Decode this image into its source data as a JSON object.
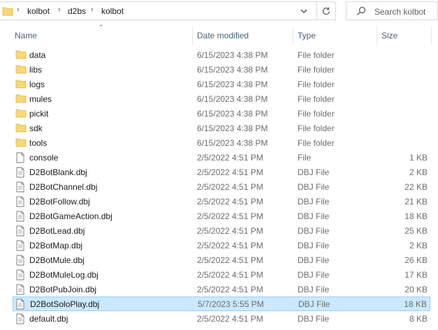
{
  "address_bar": {
    "crumbs": [
      "kolbot",
      "d2bs",
      "kolbot"
    ]
  },
  "search": {
    "placeholder": "Search kolbot"
  },
  "columns": {
    "name": "Name",
    "date": "Date modified",
    "type": "Type",
    "size": "Size"
  },
  "files": [
    {
      "name": "data",
      "date": "6/15/2023 4:38 PM",
      "type": "File folder",
      "size": "",
      "kind": "folder"
    },
    {
      "name": "libs",
      "date": "6/15/2023 4:38 PM",
      "type": "File folder",
      "size": "",
      "kind": "folder"
    },
    {
      "name": "logs",
      "date": "6/15/2023 4:38 PM",
      "type": "File folder",
      "size": "",
      "kind": "folder"
    },
    {
      "name": "mules",
      "date": "6/15/2023 4:38 PM",
      "type": "File folder",
      "size": "",
      "kind": "folder"
    },
    {
      "name": "pickit",
      "date": "6/15/2023 4:38 PM",
      "type": "File folder",
      "size": "",
      "kind": "folder"
    },
    {
      "name": "sdk",
      "date": "6/15/2023 4:38 PM",
      "type": "File folder",
      "size": "",
      "kind": "folder"
    },
    {
      "name": "tools",
      "date": "6/15/2023 4:38 PM",
      "type": "File folder",
      "size": "",
      "kind": "folder"
    },
    {
      "name": "console",
      "date": "2/5/2022 4:51 PM",
      "type": "File",
      "size": "1 KB",
      "kind": "blank"
    },
    {
      "name": "D2BotBlank.dbj",
      "date": "2/5/2022 4:51 PM",
      "type": "DBJ File",
      "size": "2 KB",
      "kind": "doc"
    },
    {
      "name": "D2BotChannel.dbj",
      "date": "2/5/2022 4:51 PM",
      "type": "DBJ File",
      "size": "22 KB",
      "kind": "doc"
    },
    {
      "name": "D2BotFollow.dbj",
      "date": "2/5/2022 4:51 PM",
      "type": "DBJ File",
      "size": "21 KB",
      "kind": "doc"
    },
    {
      "name": "D2BotGameAction.dbj",
      "date": "2/5/2022 4:51 PM",
      "type": "DBJ File",
      "size": "18 KB",
      "kind": "doc"
    },
    {
      "name": "D2BotLead.dbj",
      "date": "2/5/2022 4:51 PM",
      "type": "DBJ File",
      "size": "25 KB",
      "kind": "doc"
    },
    {
      "name": "D2BotMap.dbj",
      "date": "2/5/2022 4:51 PM",
      "type": "DBJ File",
      "size": "2 KB",
      "kind": "doc"
    },
    {
      "name": "D2BotMule.dbj",
      "date": "2/5/2022 4:51 PM",
      "type": "DBJ File",
      "size": "26 KB",
      "kind": "doc"
    },
    {
      "name": "D2BotMuleLog.dbj",
      "date": "2/5/2022 4:51 PM",
      "type": "DBJ File",
      "size": "17 KB",
      "kind": "doc"
    },
    {
      "name": "D2BotPubJoin.dbj",
      "date": "2/5/2022 4:51 PM",
      "type": "DBJ File",
      "size": "20 KB",
      "kind": "doc"
    },
    {
      "name": "D2BotSoloPlay.dbj",
      "date": "5/7/2023 5:55 PM",
      "type": "DBJ File",
      "size": "18 KB",
      "kind": "doc",
      "selected": true
    },
    {
      "name": "default.dbj",
      "date": "2/5/2022 4:51 PM",
      "type": "DBJ File",
      "size": "8 KB",
      "kind": "doc"
    }
  ],
  "colors": {
    "selection_bg": "#cce8ff",
    "selection_border": "#99d1ff",
    "folder": "#f8d775"
  }
}
